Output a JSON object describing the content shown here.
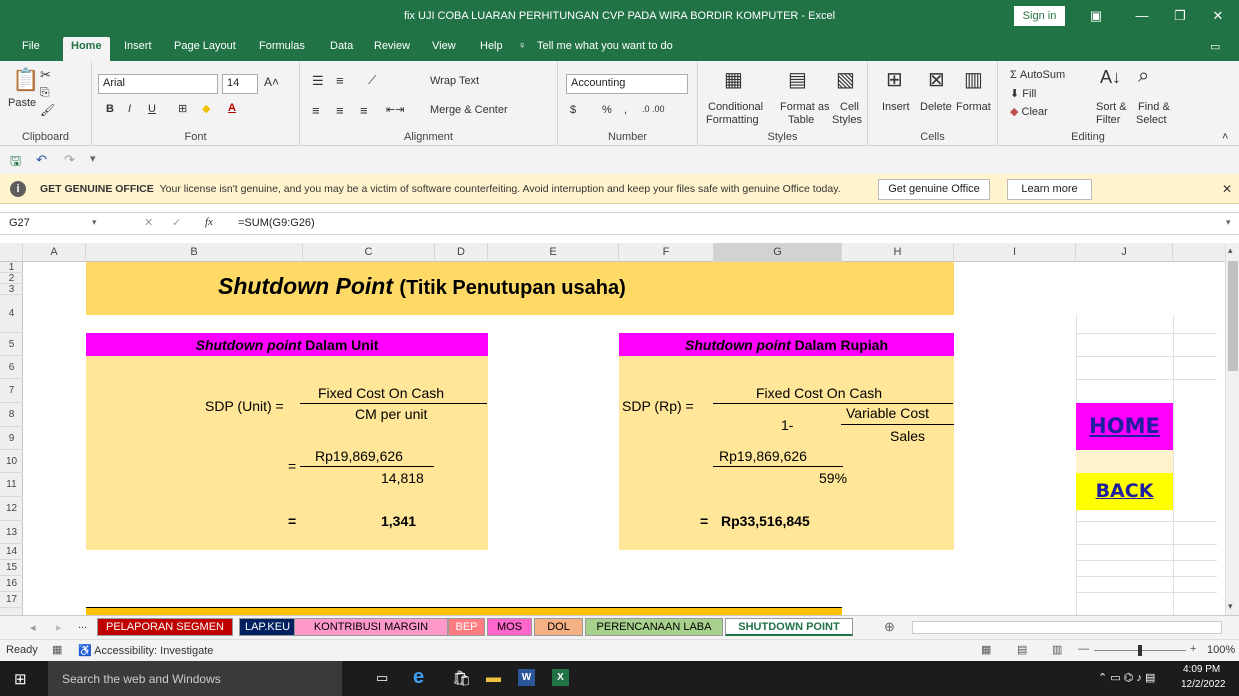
{
  "window": {
    "title": "fix UJI COBA LUARAN PERHITUNGAN CVP PADA WIRA BORDIR KOMPUTER  -  Excel",
    "sign_in": "Sign in"
  },
  "menu": {
    "tabs": [
      "File",
      "Home",
      "Insert",
      "Page Layout",
      "Formulas",
      "Data",
      "Review",
      "View",
      "Help"
    ],
    "tell_me": "Tell me what you want to do"
  },
  "ribbon": {
    "clipboard": {
      "label": "Clipboard",
      "paste": "Paste"
    },
    "font": {
      "label": "Font",
      "name": "Arial",
      "size": "14",
      "bold": "B",
      "italic": "I",
      "underline": "U"
    },
    "alignment": {
      "label": "Alignment",
      "wrap": "Wrap Text",
      "merge": "Merge & Center"
    },
    "number": {
      "label": "Number",
      "format": "Accounting",
      "currency": "$",
      "percent": "%",
      "comma": ","
    },
    "styles": {
      "label": "Styles",
      "cond1": "Conditional",
      "cond2": "Formatting",
      "fmt1": "Format as",
      "fmt2": "Table",
      "cell1": "Cell",
      "cell2": "Styles"
    },
    "cells": {
      "label": "Cells",
      "insert": "Insert",
      "delete": "Delete",
      "format": "Format"
    },
    "editing": {
      "label": "Editing",
      "autosum": "AutoSum",
      "fill": "Fill",
      "clear": "Clear",
      "sort1": "Sort &",
      "sort2": "Filter",
      "find1": "Find &",
      "find2": "Select"
    }
  },
  "warning": {
    "title": "GET GENUINE OFFICE",
    "message": "Your license isn't genuine, and you may be a victim of software counterfeiting. Avoid interruption and keep your files safe with genuine Office today.",
    "btn_genuine": "Get genuine Office",
    "btn_learn": "Learn more"
  },
  "formula_bar": {
    "cell_ref": "G27",
    "fx": "fx",
    "formula": "=SUM(G9:G26)"
  },
  "columns": [
    "A",
    "B",
    "C",
    "D",
    "E",
    "F",
    "G",
    "H",
    "I",
    "J"
  ],
  "rows": [
    "1",
    "2",
    "3",
    "4",
    "5",
    "6",
    "7",
    "8",
    "9",
    "10",
    "11",
    "12",
    "13",
    "14",
    "15",
    "16",
    "17"
  ],
  "sheet": {
    "title_italic": "Shutdown Point",
    "title_rest": "(Titik Penutupan usaha)",
    "left": {
      "header_italic": "Shutdown point",
      "header_rest": "Dalam Unit",
      "label": "SDP (Unit) =",
      "numerator": "Fixed Cost On Cash",
      "denominator": "CM per unit",
      "eq": "=",
      "num_value": "Rp19,869,626",
      "den_value": "14,818",
      "result_eq": "=",
      "result": "1,341"
    },
    "right": {
      "header_italic": "Shutdown point",
      "header_rest": "Dalam Rupiah",
      "label": "SDP (Rp) =",
      "numerator": "Fixed Cost On Cash",
      "one_minus": "1-",
      "var_cost": "Variable Cost",
      "sales": "Sales",
      "num_value": "Rp19,869,626",
      "den_value": "59%",
      "result_eq": "=",
      "result": "Rp33,516,845"
    },
    "home_btn": "HOME",
    "back_btn": "BACK"
  },
  "sheet_tabs": [
    {
      "label": "PELAPORAN SEGMEN",
      "color": "#c00000",
      "text": "#ffffff"
    },
    {
      "label": "LAP.KEU",
      "color": "#002060",
      "text": "#ffffff"
    },
    {
      "label": "KONTRIBUSI MARGIN",
      "color": "#ff99cc",
      "text": "#000000"
    },
    {
      "label": "BEP",
      "color": "#ff7c80",
      "text": "#ffffff"
    },
    {
      "label": "MOS",
      "color": "#ff66cc",
      "text": "#000000"
    },
    {
      "label": "DOL",
      "color": "#f4b183",
      "text": "#000000"
    },
    {
      "label": "PERENCANAAN LABA",
      "color": "#a9d18e",
      "text": "#000000"
    },
    {
      "label": "SHUTDOWN POINT",
      "color": "#ffffff",
      "text": "#217346"
    }
  ],
  "status": {
    "ready": "Ready",
    "accessibility": "Accessibility: Investigate",
    "zoom": "100%"
  },
  "taskbar": {
    "search": "Search the web and Windows",
    "time": "4:09 PM",
    "date": "12/2/2022"
  },
  "colors": {
    "excel_green": "#217346",
    "title_fill": "#ffd966",
    "box_fill": "#ffe699",
    "magenta": "#ff00ff",
    "yellow": "#ffff00"
  }
}
